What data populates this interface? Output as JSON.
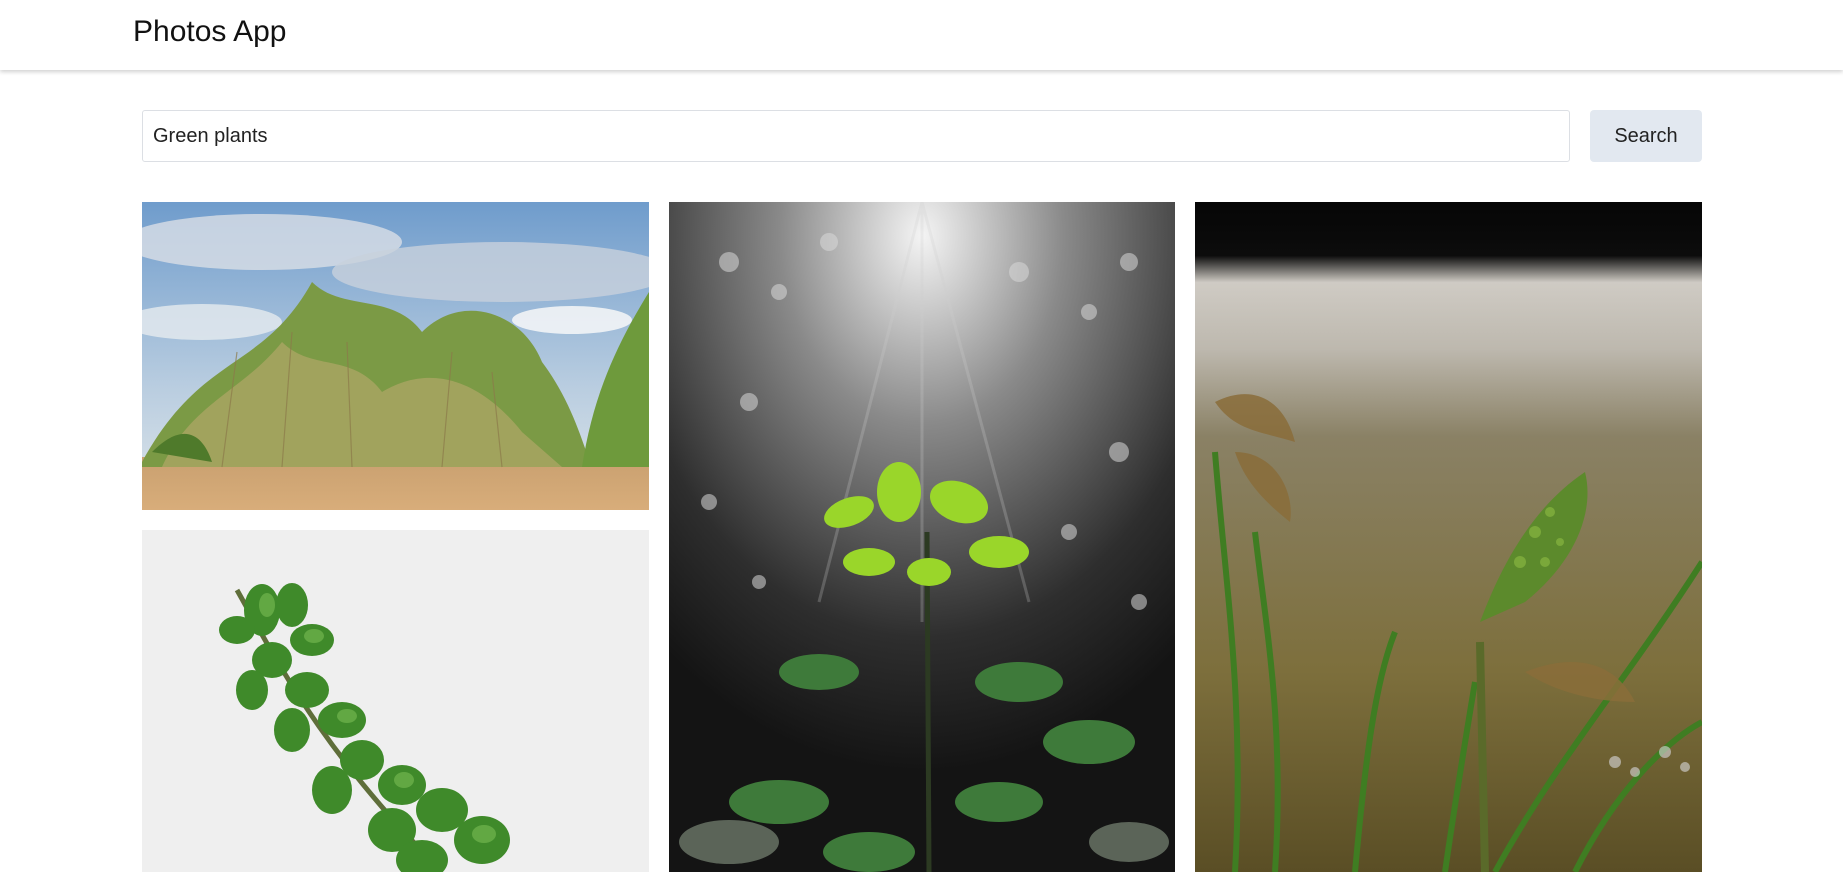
{
  "header": {
    "title": "Photos App"
  },
  "search": {
    "value": "Green plants",
    "button_label": "Search"
  },
  "photos": [
    {
      "subject": "desert shrubs under a blue cloudy sky"
    },
    {
      "subject": "green leafy branch on a white background"
    },
    {
      "subject": "green plant in sunlight with a black-and-white background"
    },
    {
      "subject": "close-up of a grass sprout in front of a stone"
    }
  ],
  "colors": {
    "search_button_bg": "#e2e8f0",
    "leaf_green": "#4f9a2e"
  }
}
